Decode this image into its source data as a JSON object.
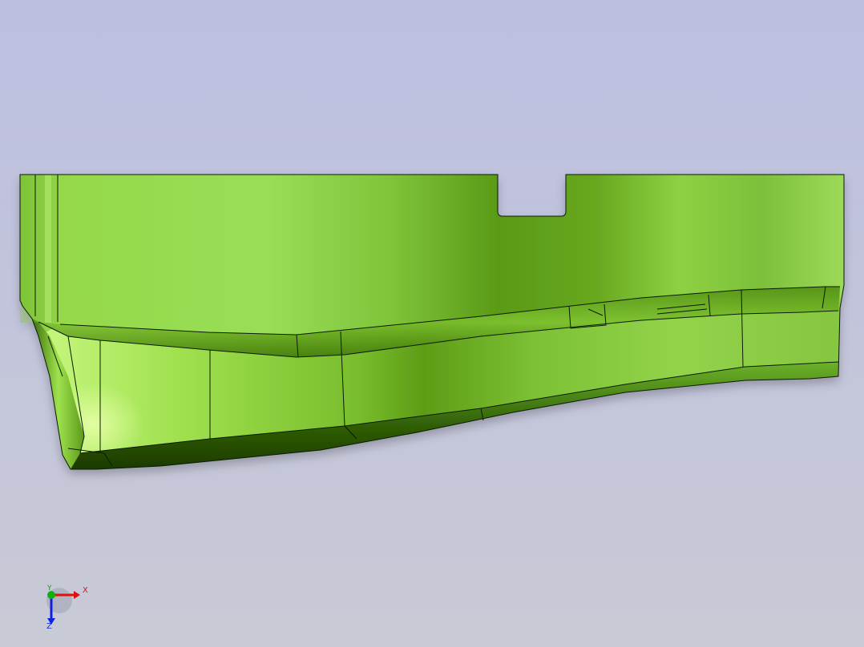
{
  "viewport": {
    "background_top": "#bcbfe0",
    "background_bottom": "#c8cad6"
  },
  "model": {
    "body_color": "#8fd63a",
    "body_highlight": "#cdfb8a",
    "body_shadow": "#3c7a10",
    "edge_color": "#0a1a05"
  },
  "triad": {
    "x_label": "X",
    "y_label": "Y",
    "z_label": "Z",
    "x_color": "#e01010",
    "y_color": "#10b010",
    "z_color": "#1020e0"
  }
}
